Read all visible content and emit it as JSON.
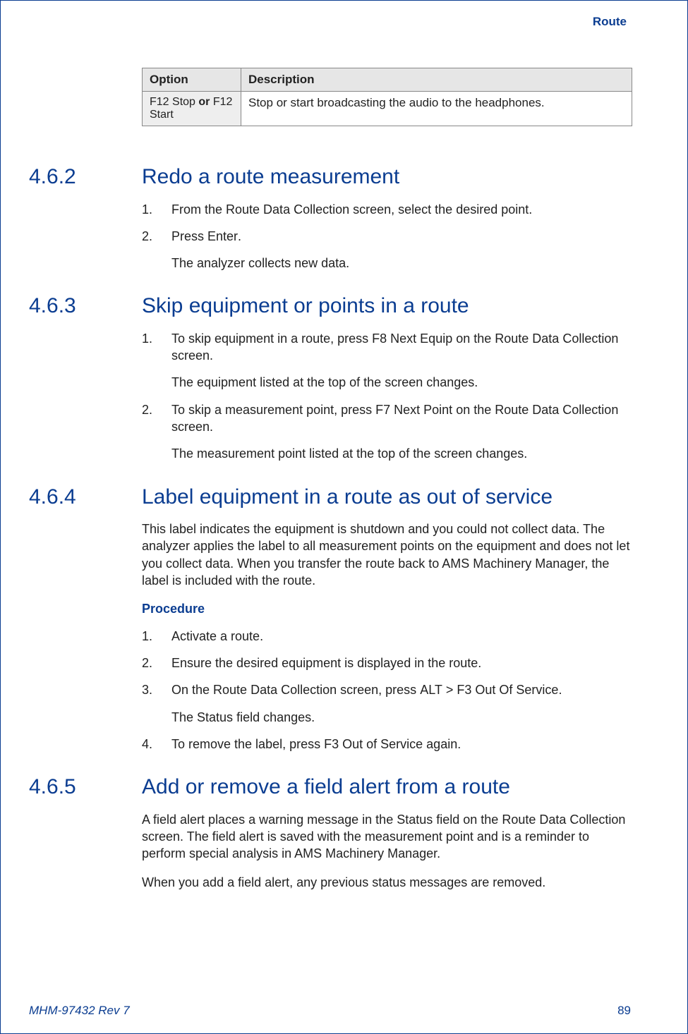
{
  "header": {
    "tag": "Route"
  },
  "table": {
    "headers": [
      "Option",
      "Description"
    ],
    "row": {
      "opt_pre": "F12 Stop",
      "opt_mid": " or ",
      "opt_post": "F12 Start",
      "desc": "Stop or start broadcasting the audio to the headphones."
    }
  },
  "s462": {
    "num": "4.6.2",
    "title": "Redo a route measurement",
    "step1": "From the Route Data Collection screen, select the desired point.",
    "step2_pre": "Press ",
    "step2_key": "Enter",
    "step2_post": ".",
    "result": "The analyzer collects new data."
  },
  "s463": {
    "num": "4.6.3",
    "title": "Skip equipment or points in a route",
    "step1_pre": "To skip equipment in a route, press ",
    "step1_key": "F8 Next Equip",
    "step1_post": " on the Route Data Collection screen.",
    "step1_res": "The equipment listed at the top of the screen changes.",
    "step2_pre": "To skip a measurement point, press ",
    "step2_key": "F7 Next Point",
    "step2_post": " on the Route Data Collection screen.",
    "step2_res": "The measurement point listed at the top of the screen changes."
  },
  "s464": {
    "num": "4.6.4",
    "title": "Label equipment in a route as out of service",
    "intro": "This label indicates the equipment is shutdown and you could not collect data. The analyzer applies the label to all measurement points on the equipment and does not let you collect data. When you transfer the route back to AMS Machinery Manager, the label is included with the route.",
    "proc": "Procedure",
    "step1": "Activate a route.",
    "step2": "Ensure the desired equipment is displayed in the route.",
    "step3_pre": "On the Route Data Collection screen, press ",
    "step3_k1": "ALT",
    "step3_mid": " > ",
    "step3_k2": "F3 Out Of Service",
    "step3_post": ".",
    "step3_res_pre": "The ",
    "step3_res_key": "Status",
    "step3_res_post": " field changes.",
    "step4_pre": "To remove the label, press ",
    "step4_key": "F3 Out of Service",
    "step4_post": " again."
  },
  "s465": {
    "num": "4.6.5",
    "title": "Add or remove a field alert from a route",
    "p1_pre": "A field alert places a warning message in the ",
    "p1_key": "Status",
    "p1_post": " field on the Route Data Collection screen. The field alert is saved with the measurement point and is a reminder to perform special analysis in AMS Machinery Manager.",
    "p2": "When you add a field alert, any previous status messages are removed."
  },
  "footer": {
    "left": "MHM-97432 Rev 7",
    "right": "89"
  }
}
